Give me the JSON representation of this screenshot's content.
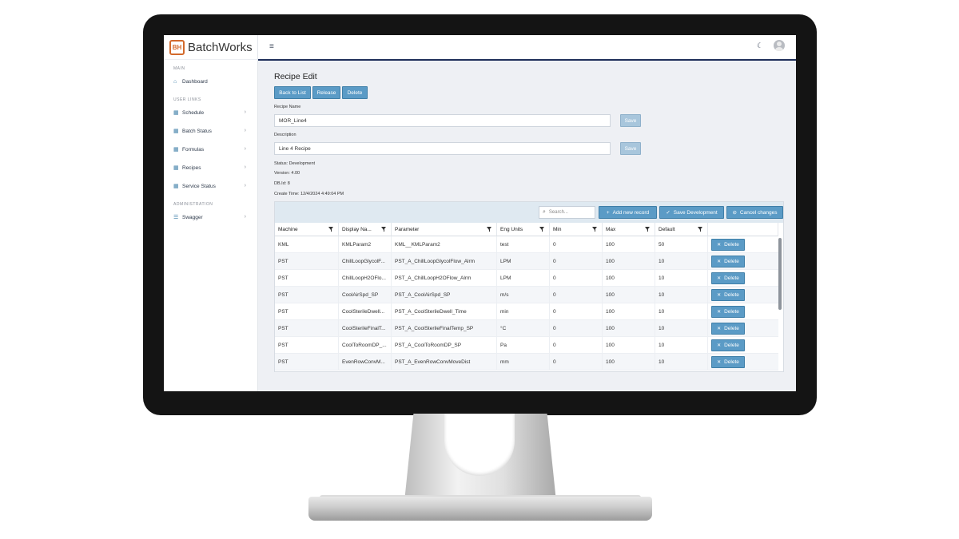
{
  "app": {
    "brand": "BatchWorks",
    "logo_mark": "BH"
  },
  "sidebar": {
    "sections": [
      {
        "label": "MAIN",
        "items": [
          {
            "label": "Dashboard",
            "icon": "home-icon",
            "chevron": false
          }
        ]
      },
      {
        "label": "USER LINKS",
        "items": [
          {
            "label": "Schedule",
            "icon": "grid-icon",
            "chevron": true
          },
          {
            "label": "Batch Status",
            "icon": "grid-icon",
            "chevron": true
          },
          {
            "label": "Formulas",
            "icon": "grid-icon",
            "chevron": true
          },
          {
            "label": "Recipes",
            "icon": "grid-icon",
            "chevron": true
          },
          {
            "label": "Service Status",
            "icon": "grid-icon",
            "chevron": true
          }
        ]
      },
      {
        "label": "ADMINISTRATION",
        "items": [
          {
            "label": "Swagger",
            "icon": "server-icon",
            "chevron": true
          }
        ]
      }
    ]
  },
  "page": {
    "title": "Recipe Edit",
    "actions": {
      "back": "Back to List",
      "release": "Release",
      "delete": "Delete"
    },
    "recipe_name": {
      "label": "Recipe Name",
      "value": "MOR_Line4",
      "save": "Save"
    },
    "description": {
      "label": "Description",
      "value": "Line 4 Recipe",
      "save": "Save"
    },
    "meta": {
      "status": "Status: Development",
      "version": "Version: 4.00",
      "dbid": "DB.Id: 8",
      "create_time": "Create Time: 12/4/2024 4:49:04 PM"
    }
  },
  "grid": {
    "search_placeholder": "Search...",
    "toolbar": {
      "add": "Add new record",
      "save_dev": "Save Development",
      "cancel": "Cancel changes"
    },
    "columns": [
      "Machine",
      "Display Na...",
      "Parameter",
      "Eng Units",
      "Min",
      "Max",
      "Default"
    ],
    "delete_label": "Delete",
    "rows": [
      [
        "KML",
        "KMLParam2",
        "KML__KMLParam2",
        "test",
        "0",
        "100",
        "50"
      ],
      [
        "PST",
        "ChillLoopGlycolF...",
        "PST_A_ChillLoopGlycolFlow_Alrm",
        "LPM",
        "0",
        "100",
        "10"
      ],
      [
        "PST",
        "ChillLoopH2OFlo...",
        "PST_A_ChillLoopH2OFlow_Alrm",
        "LPM",
        "0",
        "100",
        "10"
      ],
      [
        "PST",
        "CoolAirSpd_SP",
        "PST_A_CoolAirSpd_SP",
        "m/s",
        "0",
        "100",
        "10"
      ],
      [
        "PST",
        "CoolSterileDwell...",
        "PST_A_CoolSterileDwell_Time",
        "min",
        "0",
        "100",
        "10"
      ],
      [
        "PST",
        "CoolSterileFinalT...",
        "PST_A_CoolSterileFinalTemp_SP",
        "°C",
        "0",
        "100",
        "10"
      ],
      [
        "PST",
        "CoolToRoomDP_...",
        "PST_A_CoolToRoomDP_SP",
        "Pa",
        "0",
        "100",
        "10"
      ],
      [
        "PST",
        "EvenRowConvM...",
        "PST_A_EvenRowConvMoveDist",
        "mm",
        "0",
        "100",
        "10"
      ]
    ]
  }
}
